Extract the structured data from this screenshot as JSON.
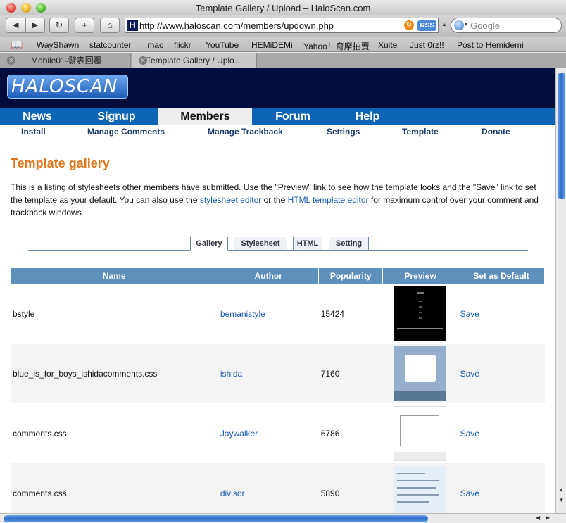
{
  "window": {
    "title": "Template Gallery / Upload – HaloScan.com"
  },
  "toolbar": {
    "back": "◀",
    "forward": "▶",
    "reload": "↻",
    "add": "+",
    "home": "⌂",
    "url": "http://www.haloscan.com/members/updown.php",
    "rss": "RSS",
    "search_placeholder": "Google",
    "favicon": "H"
  },
  "bookmarks": [
    "WayShawn",
    "statcounter",
    ".mac",
    "flickr",
    "YouTube",
    "HEMiDEMi",
    "Yahoo！奇摩拍賣",
    "Xuite",
    "Just 0rz!!",
    "Post to Hemidemi"
  ],
  "tabs": [
    {
      "label": "Mobile01-發表回覆"
    },
    {
      "label": "Template Gallery / Uplo…"
    }
  ],
  "site": {
    "logo": "HALOSCAN",
    "nav": [
      "News",
      "Signup",
      "Members",
      "Forum",
      "Help"
    ],
    "active_nav": "Members",
    "subnav": [
      "Install",
      "Manage Comments",
      "Manage Trackback",
      "Settings",
      "Template",
      "Donate"
    ]
  },
  "page": {
    "title": "Template gallery",
    "intro_1": "This is a listing of stylesheets other members have submitted. Use the \"Preview\" link to see how the template looks and the \"Save\" link to set the template as your default. You can also use the ",
    "link_stylesheet": "stylesheet editor",
    "intro_2": " or the ",
    "link_html": "HTML template editor",
    "intro_3": " for maximum control over your comment and trackback windows.",
    "tabs": [
      "Gallery",
      "Stylesheet",
      "HTML",
      "Setting"
    ],
    "active_tab": "Gallery"
  },
  "table": {
    "headers": [
      "Name",
      "Author",
      "Popularity",
      "Preview",
      "Set as Default"
    ],
    "rows": [
      {
        "name": "bstyle",
        "author": "bemanistyle",
        "popularity": "15424",
        "save": "Save"
      },
      {
        "name": "blue_is_for_boys_ishidacomments.css",
        "author": "ishida",
        "popularity": "7160",
        "save": "Save"
      },
      {
        "name": "comments.css",
        "author": "Jaywalker",
        "popularity": "6786",
        "save": "Save"
      },
      {
        "name": "comments.css",
        "author": "divisor",
        "popularity": "5890",
        "save": "Save"
      }
    ]
  },
  "colors": {
    "header_bg": "#040c3c",
    "nav_bg": "#0c64b4",
    "title_orange": "#e0781e",
    "table_header": "#5e90bc",
    "link": "#1a5ab0"
  }
}
